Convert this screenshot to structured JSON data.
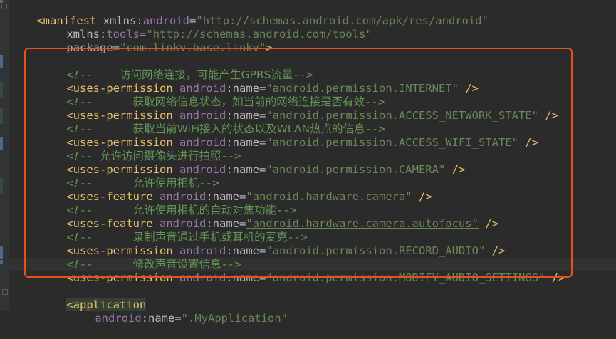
{
  "manifest": {
    "open_tag": "manifest",
    "xmlns_android": {
      "ns": "xmlns",
      "name": "android",
      "value": "\"http://schemas.android.com/apk/res/android\""
    },
    "xmlns_tools": {
      "ns": "xmlns",
      "name": "tools",
      "value": "\"http://schemas.android.com/tools\""
    },
    "package": {
      "name": "package",
      "value": "\"com.linkv.base.linkv\""
    }
  },
  "comments": {
    "internet": "访问网络连接，可能产生GPRS流量",
    "network_state": "获取网络信息状态，如当前的网络连接是否有效",
    "wifi_state": "获取当前WiFi接入的状态以及WLAN热点的信息",
    "camera_perm": "允许访问摄像头进行拍照",
    "camera_feature": "允许使用相机",
    "autofocus": "允许使用相机的自动对焦功能",
    "record_audio": "录制声音通过手机或耳机的麦克",
    "modify_audio": "修改声音设置信息"
  },
  "elements": {
    "uses_permission": "uses-permission",
    "uses_feature": "uses-feature",
    "ns_android": "android",
    "attr_name": "name"
  },
  "permissions": {
    "internet": "\"android.permission.INTERNET\"",
    "network_state": "\"android.permission.ACCESS_NETWORK_STATE\"",
    "wifi_state": "\"android.permission.ACCESS_WIFI_STATE\"",
    "camera": "\"android.permission.CAMERA\"",
    "record_audio": "\"android.permission.RECORD_AUDIO\"",
    "modify_audio": "\"android.permission.MODIFY_AUDIO_SETTINGS\""
  },
  "features": {
    "camera": "\"android.hardware.camera\"",
    "autofocus": "\"android.hardware.camera.autofocus\""
  },
  "application": {
    "tag": "application",
    "name_value": "\".MyApplication\""
  },
  "colors": {
    "background": "#2b2b2b",
    "gutter": "#313335",
    "tag": "#e8bf6a",
    "namespace": "#9876aa",
    "string": "#6a8759",
    "comment": "#629755",
    "highlight_box": "#e2531d",
    "vcs_changed_marker": "#4f6a87",
    "vcs_added_marker": "#384c38"
  }
}
